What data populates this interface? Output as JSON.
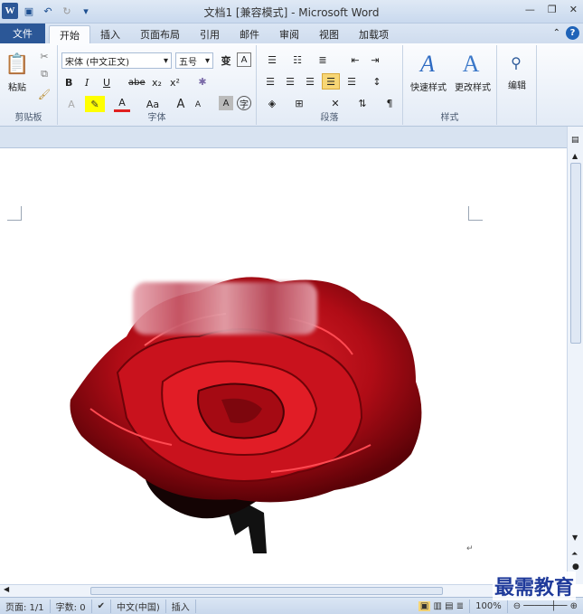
{
  "window": {
    "title": "文档1 [兼容模式] - Microsoft Word",
    "app_icon": "W",
    "controls": [
      "minimize",
      "restore",
      "close"
    ]
  },
  "qat": {
    "icons": [
      "save-icon",
      "undo-icon",
      "redo-icon",
      "customize-icon"
    ]
  },
  "tabs": [
    "文件",
    "开始",
    "插入",
    "页面布局",
    "引用",
    "邮件",
    "审阅",
    "视图",
    "加载项"
  ],
  "active_tab": "开始",
  "ribbon": {
    "clipboard": {
      "label": "剪贴板",
      "paste": "粘贴"
    },
    "font": {
      "label": "字体",
      "font_name": "宋体 (中文正文)",
      "font_size": "五号",
      "bold": "B",
      "italic": "I",
      "underline": "U",
      "strike": "abe",
      "sub": "x₂",
      "sup": "x²",
      "grow": "A",
      "shrink": "A",
      "case": "Aa",
      "clear": "A"
    },
    "paragraph": {
      "label": "段落"
    },
    "styles": {
      "label": "样式",
      "quick": "快速样式",
      "change": "更改样式"
    },
    "editing": {
      "label": "编辑"
    }
  },
  "document": {
    "image": "red rose (pasted picture)"
  },
  "status": {
    "page": "页面: 1/1",
    "words": "字数: 0",
    "language": "中文(中国)",
    "mode": "插入",
    "zoom": "100%"
  },
  "watermark": "最需教育",
  "colors": {
    "file_tab": "#2b5797",
    "highlight": "#ffff00",
    "font_color": "#e02020",
    "rose": "#c2101c"
  }
}
